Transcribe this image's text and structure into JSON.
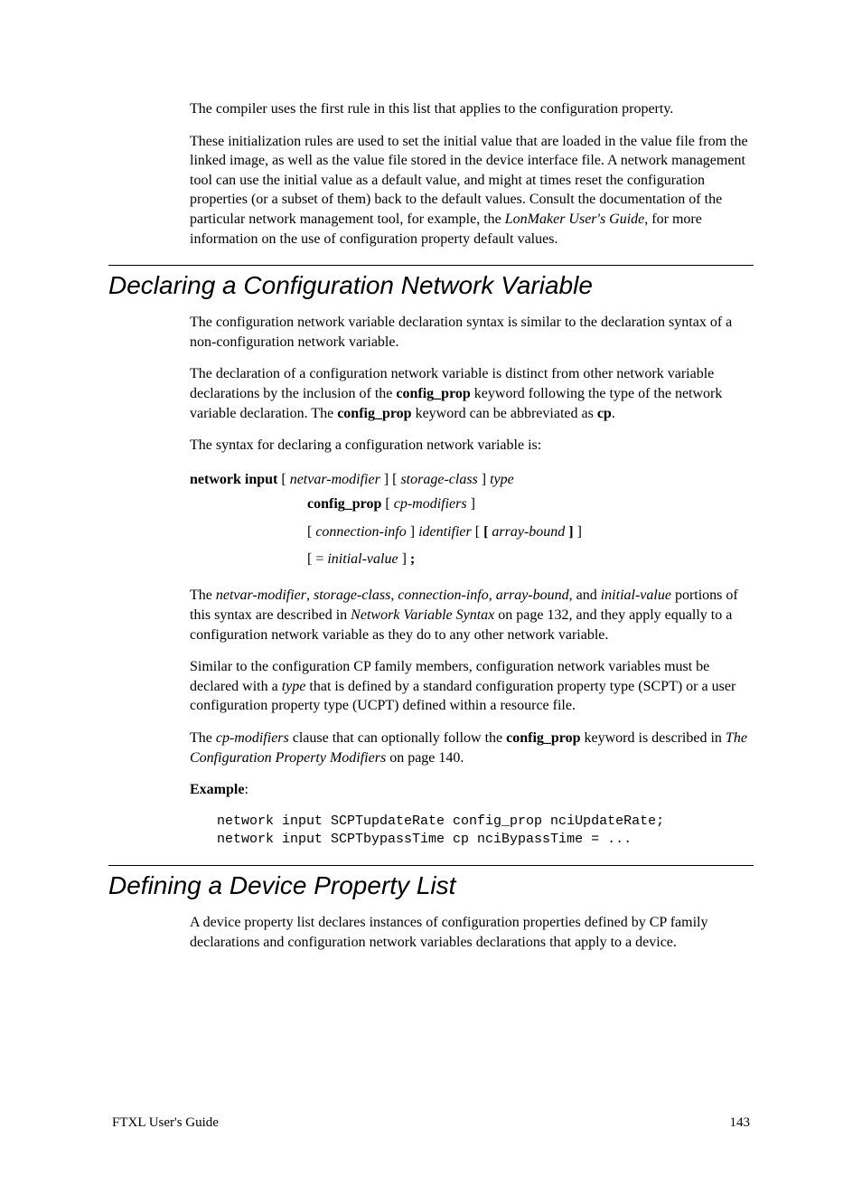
{
  "para1": "The compiler uses the first rule in this list that applies to the configuration property.",
  "para2_a": "These initialization rules are used to set the initial value that are loaded in the value file from the linked image, as well as the value file stored in the device interface file.  A network management tool can use the initial value as a default value, and might at times reset the configuration properties (or a subset of them) back to the default values.  Consult the documentation of the particular network management tool, for example, the ",
  "para2_lonmaker": "LonMaker User's Guide",
  "para2_b": ", for more information on the use of configuration property default values.",
  "sec1_title": "Declaring a Configuration Network Variable",
  "sec1_p1": "The configuration network variable declaration syntax is similar to the declaration syntax of a non-configuration network variable.",
  "sec1_p2_a": "The declaration of a configuration network variable is distinct from other network variable declarations by the inclusion of the ",
  "kw_config_prop": "config_prop",
  "sec1_p2_b": " keyword following the type of the network variable declaration.  The ",
  "sec1_p2_c": " keyword can be abbreviated as ",
  "kw_cp": "cp",
  "period": ".",
  "sec1_p3": "The syntax for declaring a configuration network variable is:",
  "syntax_network_input": "network input",
  "syntax_lb": "  [ ",
  "syntax_netvar": "netvar-modifier",
  "syntax_mb": " ] [ ",
  "syntax_storage": "storage-class",
  "syntax_rb": " ] ",
  "syntax_type": "type",
  "syntax_line2_a": " [ ",
  "syntax_cpmod": "cp-modifiers",
  "syntax_line2_b": " ]",
  "syntax_line3_a": "[ ",
  "syntax_conninfo": "connection-info",
  "syntax_line3_b": " ] ",
  "syntax_identifier": "identifier",
  "syntax_line3_c": " [ ",
  "syntax_lbr": "[ ",
  "syntax_arraybound": "array-bound ",
  "syntax_rbr": "]",
  "syntax_line3_d": " ]",
  "syntax_line4_a": "[ = ",
  "syntax_initval": "initial-value",
  "syntax_line4_b": " ] ",
  "syntax_semi": ";",
  "sec1_p4_a": "The ",
  "sec1_p4_netvar": "netvar-modifier",
  "comma_sp": ", ",
  "sec1_p4_storage": "storage-class",
  "sec1_p4_conninfo": "connection-info",
  "sec1_p4_arraybound": "array-bound",
  "and_sp": ", and ",
  "sec1_p4_initval": "initial-value",
  "sec1_p4_b": " portions of this syntax are described in ",
  "sec1_p4_nvs": "Network Variable Syntax",
  "sec1_p4_c": " on page 132, and they apply equally to a configuration network variable as they do to any other network variable.",
  "sec1_p5_a": "Similar to the configuration CP family members, configuration network variables must be declared with a ",
  "sec1_p5_type": "type",
  "sec1_p5_b": " that is defined by a standard configuration property type (SCPT) or a user configuration property type (UCPT) defined within a resource file.",
  "sec1_p6_a": "The ",
  "sec1_p6_cpmod": "cp-modifiers",
  "sec1_p6_b": " clause that can optionally follow the ",
  "sec1_p6_c": " keyword is described in ",
  "sec1_p6_tcpm": "The Configuration Property Modifiers",
  "sec1_p6_d": " on page 140.",
  "example_label": "Example",
  "colon": ":",
  "code": "network input SCPTupdateRate config_prop nciUpdateRate;\nnetwork input SCPTbypassTime cp nciBypassTime = ...",
  "sec2_title": "Defining a Device Property List",
  "sec2_p1": "A device property list declares instances of configuration properties defined by CP family declarations and configuration network variables declarations that apply to a device.",
  "footer_left": "FTXL User's Guide",
  "footer_right": "143"
}
